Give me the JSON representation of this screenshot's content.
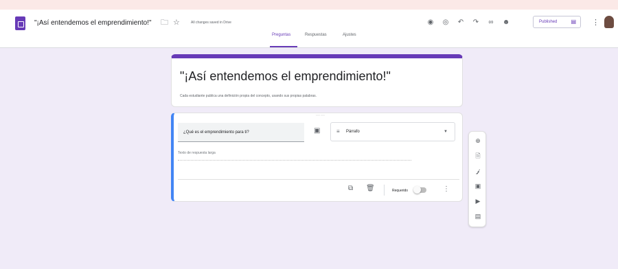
{
  "header": {
    "doc_title": "\"¡Así entendemos el emprendimiento!\"",
    "saved_status": "All changes saved in Drive",
    "published_label": "Published",
    "icons": [
      "folder-icon",
      "star-icon",
      "palette-icon",
      "preview-icon",
      "undo-icon",
      "redo-icon",
      "link-icon",
      "add-collaborator-icon",
      "more-vert-icon"
    ]
  },
  "tabs": [
    {
      "label": "Preguntas",
      "active": true
    },
    {
      "label": "Respuestas",
      "active": false
    },
    {
      "label": "Ajustes",
      "active": false
    }
  ],
  "form": {
    "title": "\"¡Así entendemos el emprendimiento!\"",
    "description": "Cada estudiante publica una definición propia del concepto, usando sus propias palabras."
  },
  "question": {
    "title": "¿Qué es el emprendimiento para ti?",
    "type": "Párrafo",
    "answer_placeholder": "Texto de respuesta larga",
    "required_label": "Requerido",
    "required": false
  },
  "toolbar": {
    "items": [
      "add-question-icon",
      "import-questions-icon",
      "add-title-icon",
      "add-image-icon",
      "add-video-icon",
      "add-section-icon"
    ]
  },
  "colors": {
    "accent": "#673ab7",
    "background": "#f0ebf8",
    "active_question": "#4285f4"
  }
}
